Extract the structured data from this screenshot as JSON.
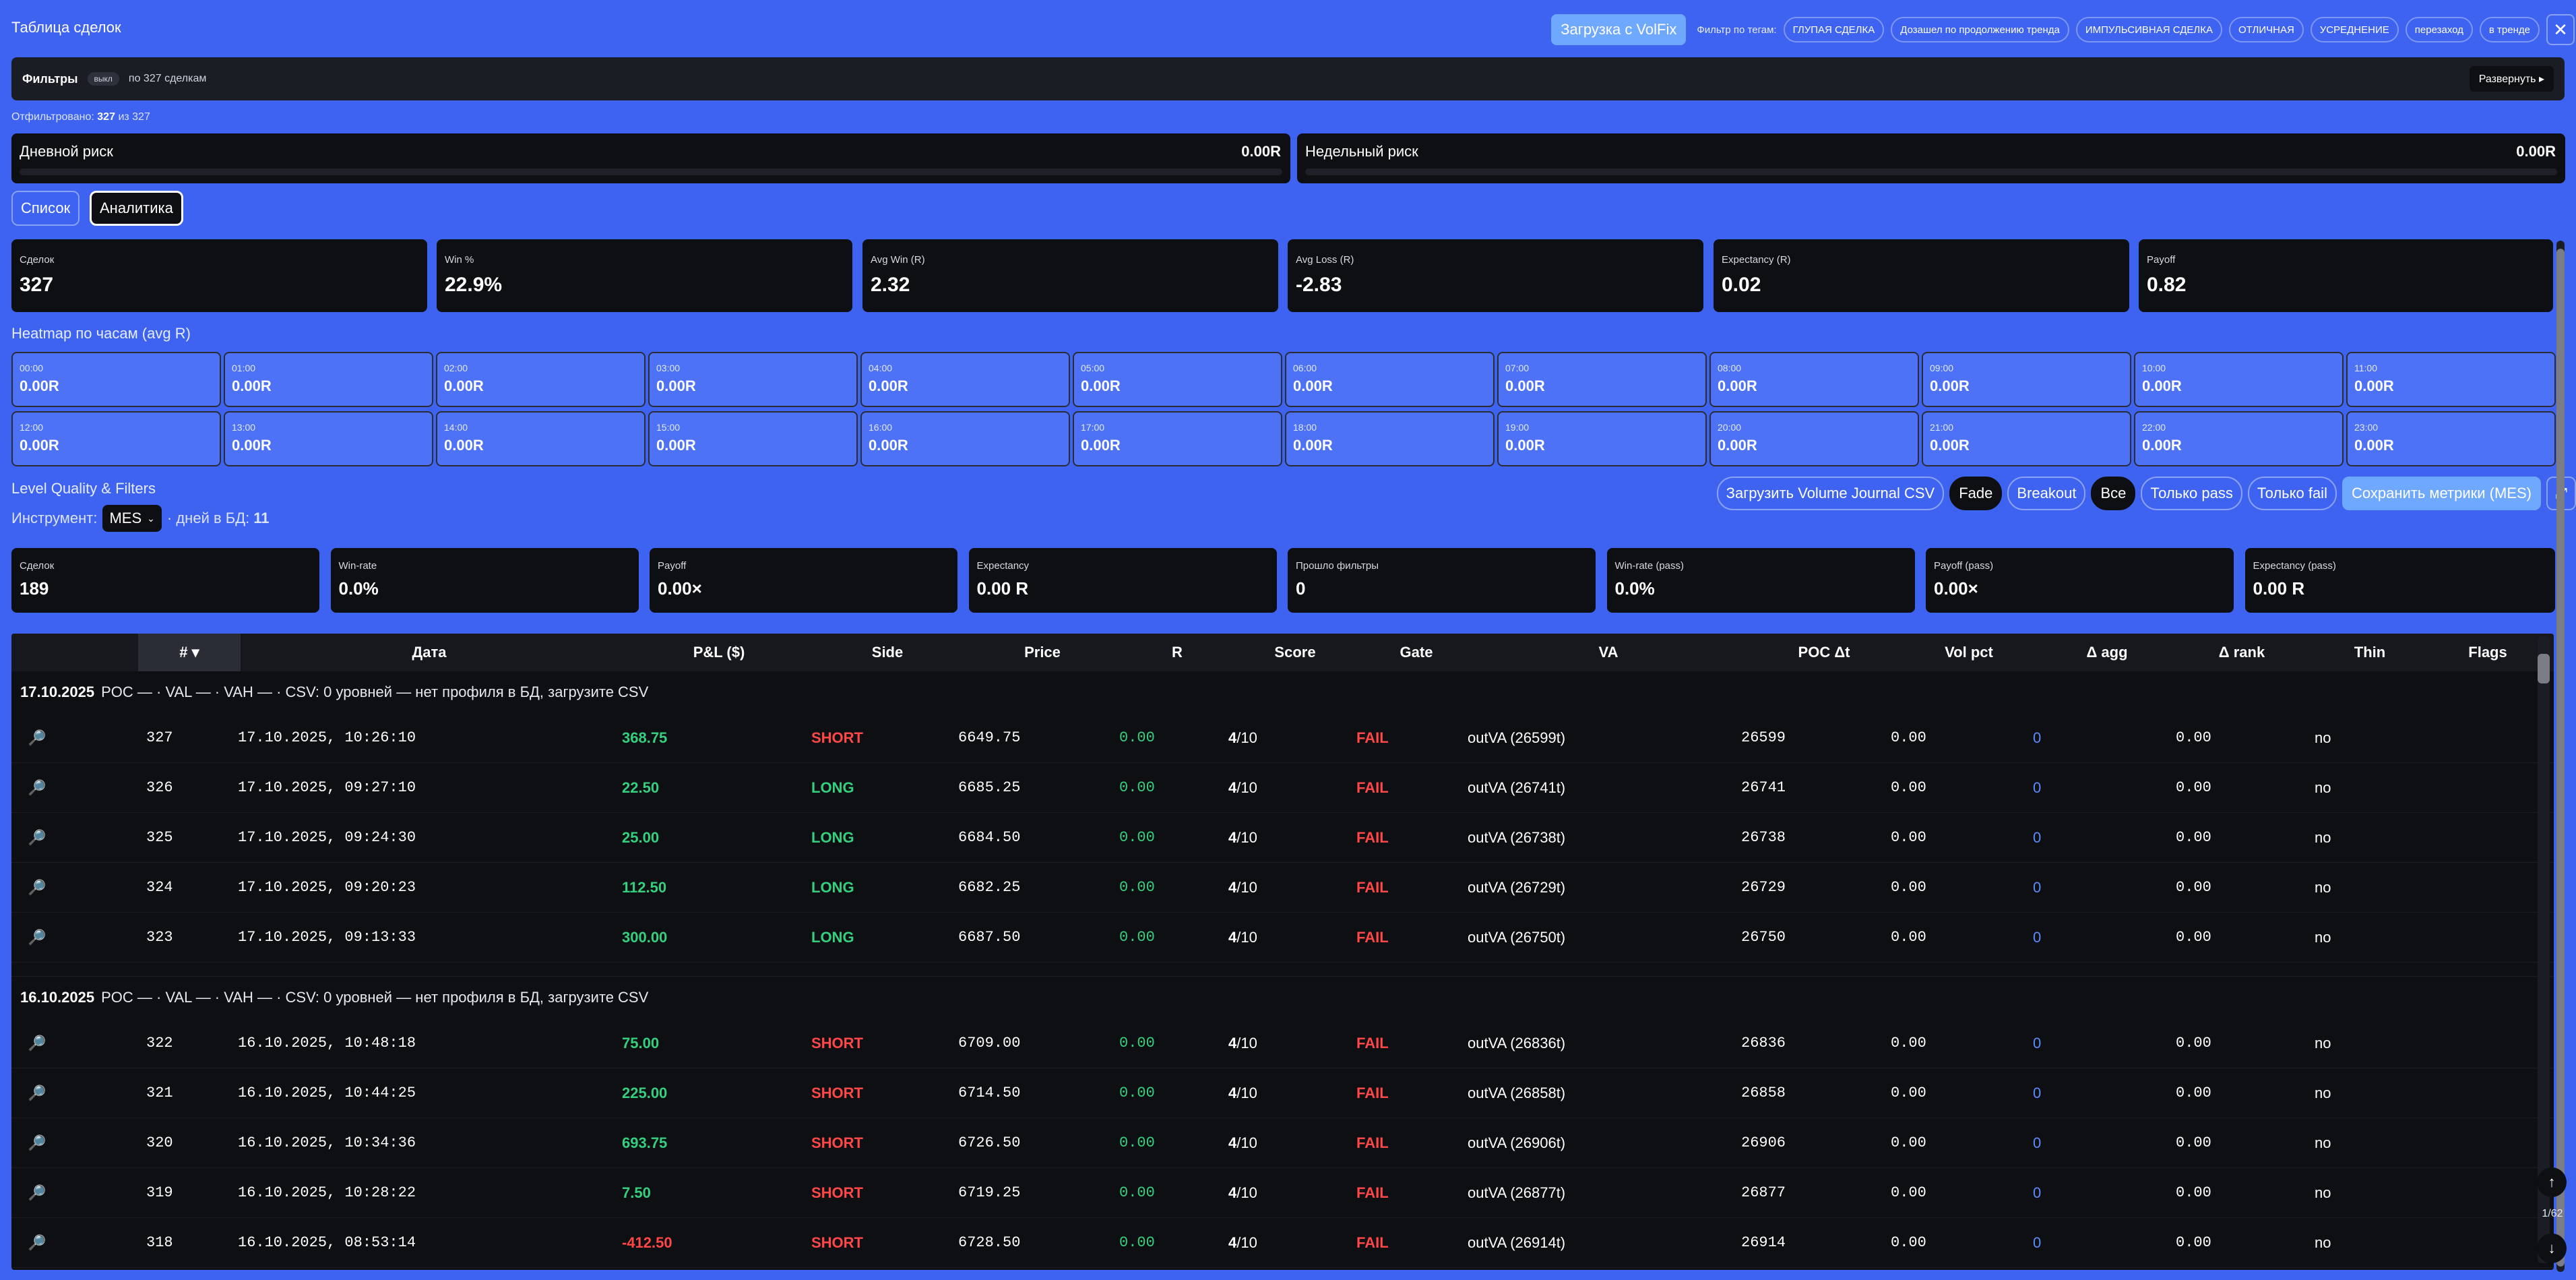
{
  "header": {
    "title": "Таблица сделок",
    "volfix_button": "Загрузка с VolFix",
    "tag_filter_label": "Фильтр по тегам:",
    "tags": [
      "ГЛУПАЯ СДЕЛКА",
      "Дозашел по продолжению тренда",
      "ИМПУЛЬСИВНАЯ СДЕЛКА",
      "ОТЛИЧНАЯ",
      "УСРЕДНЕНИЕ",
      "перезаход",
      "в тренде"
    ],
    "close_glyph": "✕"
  },
  "filters": {
    "title": "Фильтры",
    "state": "выкл",
    "count_text": "по 327 сделкам",
    "expand_button": "Развернуть ▸"
  },
  "filtered": {
    "label": "Отфильтровано:",
    "count": "327",
    "of_text": "из 327"
  },
  "risk": {
    "daily": {
      "label": "Дневной риск",
      "value": "0.00R"
    },
    "weekly": {
      "label": "Недельный риск",
      "value": "0.00R"
    }
  },
  "tabs": {
    "list": "Список",
    "analytics": "Аналитика"
  },
  "stats": [
    {
      "label": "Сделок",
      "value": "327"
    },
    {
      "label": "Win %",
      "value": "22.9%"
    },
    {
      "label": "Avg Win (R)",
      "value": "2.32"
    },
    {
      "label": "Avg Loss (R)",
      "value": "-2.83"
    },
    {
      "label": "Expectancy (R)",
      "value": "0.02"
    },
    {
      "label": "Payoff",
      "value": "0.82"
    }
  ],
  "heatmap": {
    "title": "Heatmap по часам (avg R)",
    "cells": [
      {
        "hour": "00:00",
        "value": "0.00R"
      },
      {
        "hour": "01:00",
        "value": "0.00R"
      },
      {
        "hour": "02:00",
        "value": "0.00R"
      },
      {
        "hour": "03:00",
        "value": "0.00R"
      },
      {
        "hour": "04:00",
        "value": "0.00R"
      },
      {
        "hour": "05:00",
        "value": "0.00R"
      },
      {
        "hour": "06:00",
        "value": "0.00R"
      },
      {
        "hour": "07:00",
        "value": "0.00R"
      },
      {
        "hour": "08:00",
        "value": "0.00R"
      },
      {
        "hour": "09:00",
        "value": "0.00R"
      },
      {
        "hour": "10:00",
        "value": "0.00R"
      },
      {
        "hour": "11:00",
        "value": "0.00R"
      },
      {
        "hour": "12:00",
        "value": "0.00R"
      },
      {
        "hour": "13:00",
        "value": "0.00R"
      },
      {
        "hour": "14:00",
        "value": "0.00R"
      },
      {
        "hour": "15:00",
        "value": "0.00R"
      },
      {
        "hour": "16:00",
        "value": "0.00R"
      },
      {
        "hour": "17:00",
        "value": "0.00R"
      },
      {
        "hour": "18:00",
        "value": "0.00R"
      },
      {
        "hour": "19:00",
        "value": "0.00R"
      },
      {
        "hour": "20:00",
        "value": "0.00R"
      },
      {
        "hour": "21:00",
        "value": "0.00R"
      },
      {
        "hour": "22:00",
        "value": "0.00R"
      },
      {
        "hour": "23:00",
        "value": "0.00R"
      }
    ]
  },
  "level_quality": {
    "title": "Level Quality & Filters",
    "instrument_label": "Инструмент:",
    "instrument_value": "MES",
    "days_label": "· дней в БД:",
    "days_value": "11",
    "buttons": {
      "load_csv": "Загрузить Volume Journal CSV",
      "fade": "Fade",
      "breakout": "Breakout",
      "all": "Все",
      "only_pass": "Только pass",
      "only_fail": "Только fail",
      "save_metrics": "Сохранить метрики (MES)",
      "expand_glyph": "⤢"
    },
    "cards": [
      {
        "label": "Сделок",
        "value": "189"
      },
      {
        "label": "Win-rate",
        "value": "0.0%"
      },
      {
        "label": "Payoff",
        "value": "0.00×"
      },
      {
        "label": "Expectancy",
        "value": "0.00 R"
      },
      {
        "label": "Прошло фильтры",
        "value": "0"
      },
      {
        "label": "Win-rate (pass)",
        "value": "0.0%"
      },
      {
        "label": "Payoff (pass)",
        "value": "0.00×"
      },
      {
        "label": "Expectancy (pass)",
        "value": "0.00 R"
      }
    ]
  },
  "table": {
    "columns": [
      "# ▾",
      "Дата",
      "P&L ($)",
      "Side",
      "Price",
      "R",
      "Score",
      "Gate",
      "VA",
      "POC Δt",
      "Vol pct",
      "Δ agg",
      "Δ rank",
      "Thin",
      "Flags"
    ],
    "row_icon": "🔎",
    "groups": [
      {
        "date": "17.10.2025",
        "info": "POC — · VAL — · VAH — · CSV: 0 уровней  — нет профиля в БД, загрузите CSV",
        "rows": [
          {
            "num": "327",
            "date": "17.10.2025, 10:26:10",
            "pnl": "368.75",
            "pnl_sign": "pos",
            "side": "SHORT",
            "price": "6649.75",
            "r": "0.00",
            "score_n": "4",
            "score_d": "/10",
            "gate": "FAIL",
            "va": "outVA (26599t)",
            "poc": "26599",
            "vol": "0.00",
            "dagg": "0",
            "drank": "0.00",
            "thin": "no",
            "flags": ""
          },
          {
            "num": "326",
            "date": "17.10.2025, 09:27:10",
            "pnl": "22.50",
            "pnl_sign": "pos",
            "side": "LONG",
            "price": "6685.25",
            "r": "0.00",
            "score_n": "4",
            "score_d": "/10",
            "gate": "FAIL",
            "va": "outVA (26741t)",
            "poc": "26741",
            "vol": "0.00",
            "dagg": "0",
            "drank": "0.00",
            "thin": "no",
            "flags": ""
          },
          {
            "num": "325",
            "date": "17.10.2025, 09:24:30",
            "pnl": "25.00",
            "pnl_sign": "pos",
            "side": "LONG",
            "price": "6684.50",
            "r": "0.00",
            "score_n": "4",
            "score_d": "/10",
            "gate": "FAIL",
            "va": "outVA (26738t)",
            "poc": "26738",
            "vol": "0.00",
            "dagg": "0",
            "drank": "0.00",
            "thin": "no",
            "flags": ""
          },
          {
            "num": "324",
            "date": "17.10.2025, 09:20:23",
            "pnl": "112.50",
            "pnl_sign": "pos",
            "side": "LONG",
            "price": "6682.25",
            "r": "0.00",
            "score_n": "4",
            "score_d": "/10",
            "gate": "FAIL",
            "va": "outVA (26729t)",
            "poc": "26729",
            "vol": "0.00",
            "dagg": "0",
            "drank": "0.00",
            "thin": "no",
            "flags": ""
          },
          {
            "num": "323",
            "date": "17.10.2025, 09:13:33",
            "pnl": "300.00",
            "pnl_sign": "pos",
            "side": "LONG",
            "price": "6687.50",
            "r": "0.00",
            "score_n": "4",
            "score_d": "/10",
            "gate": "FAIL",
            "va": "outVA (26750t)",
            "poc": "26750",
            "vol": "0.00",
            "dagg": "0",
            "drank": "0.00",
            "thin": "no",
            "flags": ""
          }
        ]
      },
      {
        "date": "16.10.2025",
        "info": "POC — · VAL — · VAH — · CSV: 0 уровней  — нет профиля в БД, загрузите CSV",
        "rows": [
          {
            "num": "322",
            "date": "16.10.2025, 10:48:18",
            "pnl": "75.00",
            "pnl_sign": "pos",
            "side": "SHORT",
            "price": "6709.00",
            "r": "0.00",
            "score_n": "4",
            "score_d": "/10",
            "gate": "FAIL",
            "va": "outVA (26836t)",
            "poc": "26836",
            "vol": "0.00",
            "dagg": "0",
            "drank": "0.00",
            "thin": "no",
            "flags": ""
          },
          {
            "num": "321",
            "date": "16.10.2025, 10:44:25",
            "pnl": "225.00",
            "pnl_sign": "pos",
            "side": "SHORT",
            "price": "6714.50",
            "r": "0.00",
            "score_n": "4",
            "score_d": "/10",
            "gate": "FAIL",
            "va": "outVA (26858t)",
            "poc": "26858",
            "vol": "0.00",
            "dagg": "0",
            "drank": "0.00",
            "thin": "no",
            "flags": ""
          },
          {
            "num": "320",
            "date": "16.10.2025, 10:34:36",
            "pnl": "693.75",
            "pnl_sign": "pos",
            "side": "SHORT",
            "price": "6726.50",
            "r": "0.00",
            "score_n": "4",
            "score_d": "/10",
            "gate": "FAIL",
            "va": "outVA (26906t)",
            "poc": "26906",
            "vol": "0.00",
            "dagg": "0",
            "drank": "0.00",
            "thin": "no",
            "flags": ""
          },
          {
            "num": "319",
            "date": "16.10.2025, 10:28:22",
            "pnl": "7.50",
            "pnl_sign": "pos",
            "side": "SHORT",
            "price": "6719.25",
            "r": "0.00",
            "score_n": "4",
            "score_d": "/10",
            "gate": "FAIL",
            "va": "outVA (26877t)",
            "poc": "26877",
            "vol": "0.00",
            "dagg": "0",
            "drank": "0.00",
            "thin": "no",
            "flags": ""
          },
          {
            "num": "318",
            "date": "16.10.2025, 08:53:14",
            "pnl": "-412.50",
            "pnl_sign": "neg",
            "side": "SHORT",
            "price": "6728.50",
            "r": "0.00",
            "score_n": "4",
            "score_d": "/10",
            "gate": "FAIL",
            "va": "outVA (26914t)",
            "poc": "26914",
            "vol": "0.00",
            "dagg": "0",
            "drank": "0.00",
            "thin": "no",
            "flags": ""
          }
        ]
      }
    ],
    "pager": {
      "up_glyph": "↑",
      "page": "1/62",
      "down_glyph": "↓"
    }
  },
  "colors": {
    "background": "#3d63f0",
    "panel": "#0e0f13",
    "positive": "#35d07f",
    "negative": "#ff4747",
    "link": "#5b8cff"
  }
}
